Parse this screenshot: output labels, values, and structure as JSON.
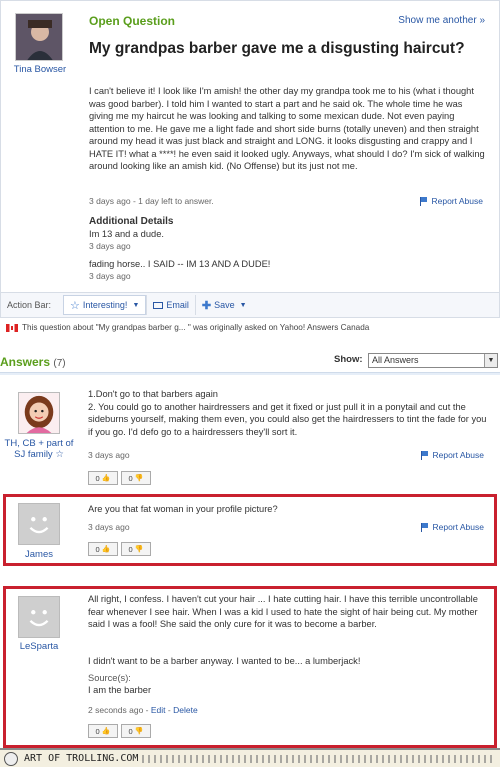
{
  "question": {
    "label": "Open Question",
    "show_me": "Show me another »",
    "user": "Tina Bowser",
    "title": "My grandpas barber gave me a disgusting haircut?",
    "body": "I can't believe it! I look like I'm amish! the other day my grandpa took me to his (what i thought was good barber). I told him I wanted to start a part and he said ok. The whole time he was giving me my haircut he was looking and talking to some mexican dude. Not even paying attention to me. He gave me a light fade and short side burns (totally uneven) and then straight around my head it was just black and straight and LONG. it looks disgusting and crappy and I HATE IT! what a ****! he even said it looked ugly. Anyways, what should I do? I'm sick of walking around looking like an amish kid. (No Offense) but its just not me.",
    "meta": "3 days ago - 1 day left to answer.",
    "report": "Report Abuse",
    "additional_title": "Additional Details",
    "additional": [
      {
        "text": "Im 13 and a dude.",
        "meta": "3 days ago"
      },
      {
        "text": "fading horse.. I SAID -- IM 13 AND A DUDE!",
        "meta": "3 days ago"
      }
    ]
  },
  "action_bar": {
    "label": "Action Bar:",
    "interesting": "Interesting!",
    "email": "Email",
    "save": "Save"
  },
  "origin": "This question about \"My grandpas barber g... \" was originally asked on Yahoo! Answers Canada",
  "answers_header": {
    "title": "Answers",
    "count": "(7)",
    "show_label": "Show:",
    "show_value": "All Answers"
  },
  "answers": [
    {
      "user": "TH, CB + part of SJ family ☆",
      "body_lines": [
        "1.Don't go to that barbers again",
        "2. You could go to another hairdressers and get it fixed or just pull it in a ponytail and cut the sideburns yourself, making them even, you could also get the hairdressers to tint the fade for you if you go. I'd defo go to a hairdressers they'll sort it."
      ],
      "meta": "3 days ago",
      "report": "Report Abuse",
      "up": "0",
      "down": "0"
    },
    {
      "user": "James",
      "body": "Are you that fat woman in your profile picture?",
      "meta": "3 days ago",
      "report": "Report Abuse",
      "up": "0",
      "down": "0"
    },
    {
      "user": "LeSparta",
      "body": "All right, I confess. I haven't cut your hair ... I hate cutting hair. I have this terrible uncontrollable fear whenever I see hair. When I was a kid I used to hate the sight of hair being cut. My mother said I was a fool! She said the only cure for it was to become a barber.",
      "body2": "I didn't want to be a barber anyway. I wanted to be... a lumberjack!",
      "source_label": "Source(s):",
      "source": "I am the barber",
      "meta": "2 seconds ago",
      "edit": "Edit",
      "delete": "Delete",
      "up": "0",
      "down": "0"
    }
  ],
  "footer": {
    "text": "ART OF TROLLING.COM"
  },
  "colors": {
    "accent_green": "#5a9e1c",
    "link_blue": "#2957a4",
    "highlight_red": "#c9202e"
  }
}
